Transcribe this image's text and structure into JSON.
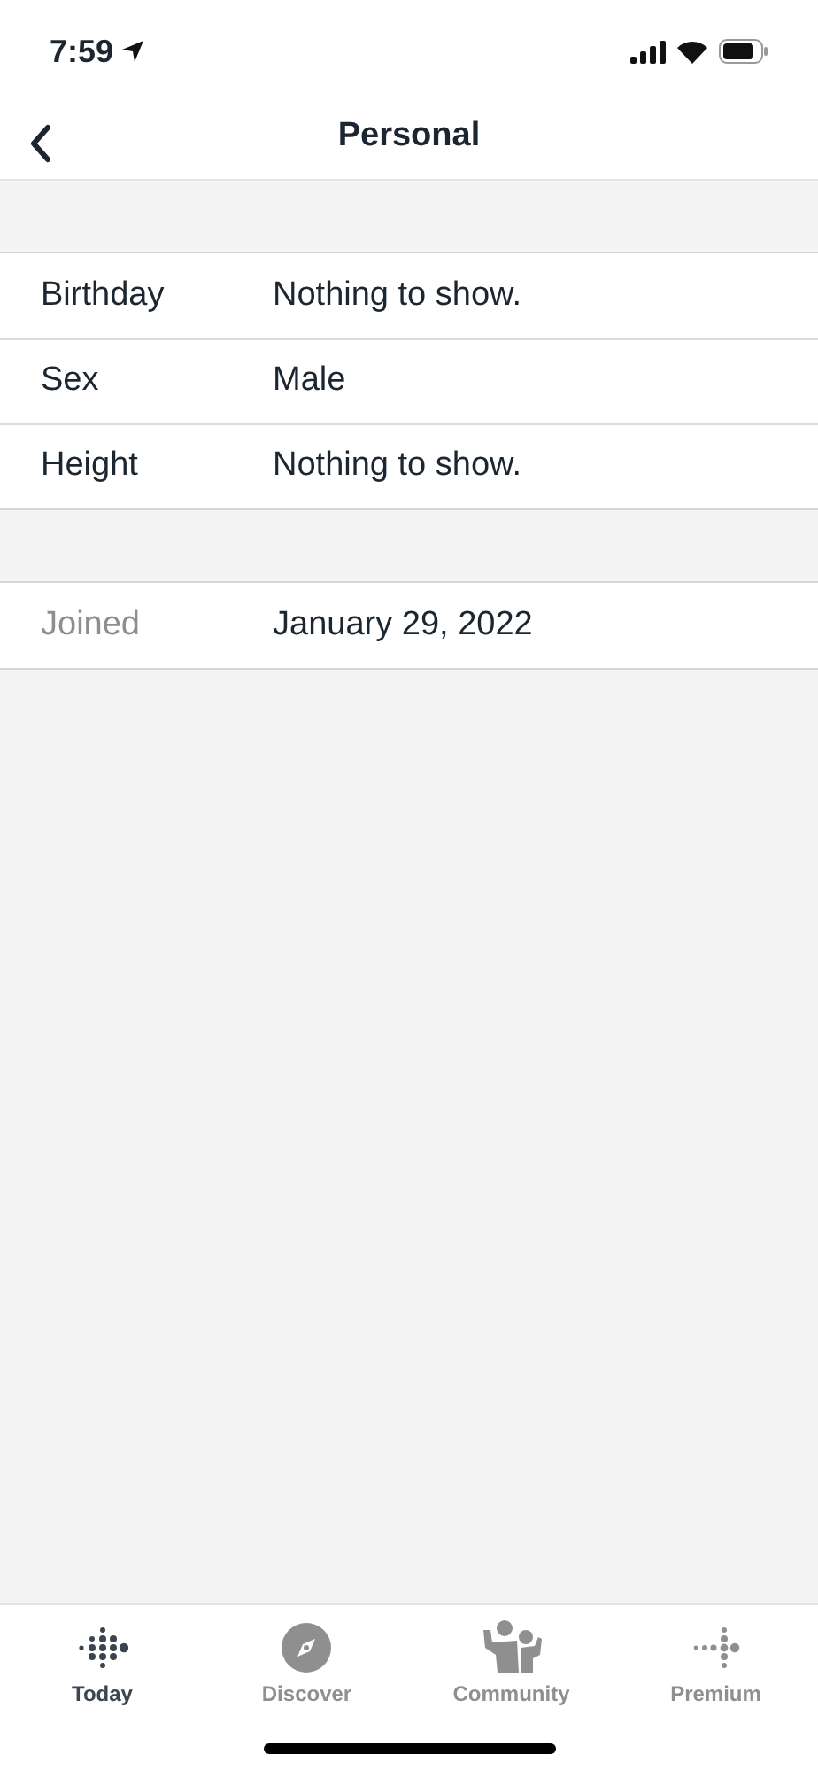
{
  "status_bar": {
    "time": "7:59"
  },
  "nav": {
    "title": "Personal"
  },
  "sections": [
    {
      "rows": [
        {
          "label": "Birthday",
          "value": "Nothing to show.",
          "dimmed": false
        },
        {
          "label": "Sex",
          "value": "Male",
          "dimmed": false
        },
        {
          "label": "Height",
          "value": "Nothing to show.",
          "dimmed": false
        }
      ]
    },
    {
      "rows": [
        {
          "label": "Joined",
          "value": "January 29, 2022",
          "dimmed": true
        }
      ]
    }
  ],
  "tabs": [
    {
      "label": "Today",
      "kind": "today",
      "selected": true
    },
    {
      "label": "Discover",
      "kind": "discover",
      "selected": false
    },
    {
      "label": "Community",
      "kind": "community",
      "selected": false
    },
    {
      "label": "Premium",
      "kind": "premium",
      "selected": false
    }
  ]
}
